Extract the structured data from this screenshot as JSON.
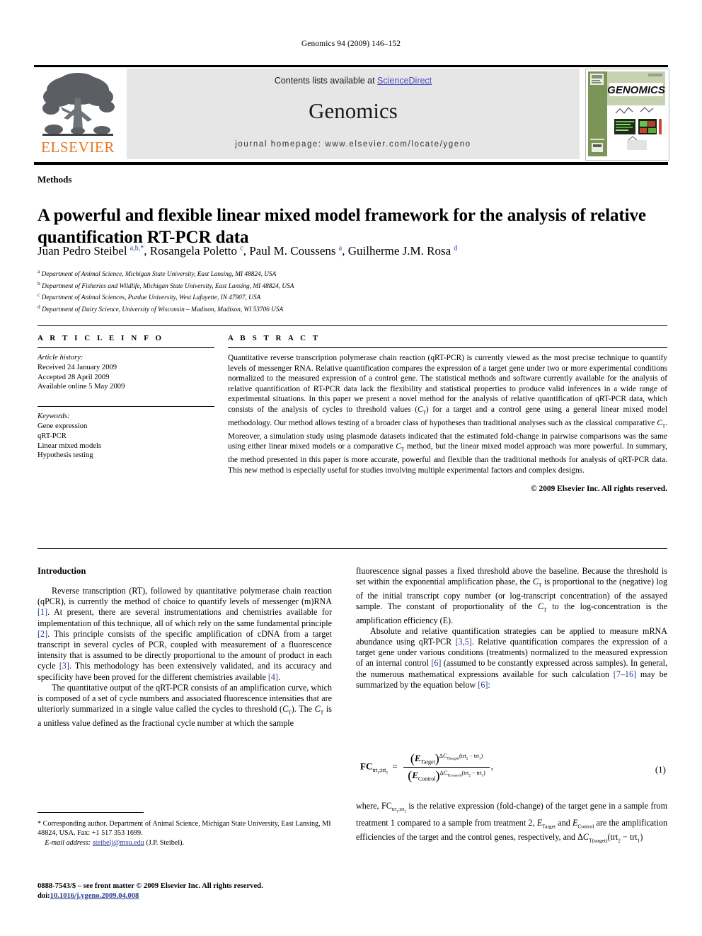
{
  "running_head": "Genomics 94 (2009) 146–152",
  "banner": {
    "publisher_wordmark": "ELSEVIER",
    "contents_prefix": "Contents lists available at ",
    "contents_link": "ScienceDirect",
    "journal_name": "Genomics",
    "homepage_line": "journal homepage: www.elsevier.com/locate/ygeno",
    "cover_title": "GENOMICS",
    "link_color": "#4a4ac4",
    "elsevier_orange": "#E87722",
    "banner_bg": "#e6e6e6"
  },
  "article": {
    "section_kind": "Methods",
    "title": "A powerful and flexible linear mixed model framework for the analysis of relative quantification RT-PCR data",
    "authors_html": "Juan Pedro Steibel <sup>a,b,*</sup>, Rosangela Poletto <sup>c</sup>, Paul M. Coussens <sup>a</sup>, Guilherme J.M. Rosa <sup>d</sup>",
    "affiliations": [
      {
        "mark": "a",
        "text": "Department of Animal Science, Michigan State University, East Lansing, MI 48824, USA"
      },
      {
        "mark": "b",
        "text": "Department of Fisheries and Wildlife, Michigan State University, East Lansing, MI 48824, USA"
      },
      {
        "mark": "c",
        "text": "Department of Animal Sciences, Purdue University, West Lafayette, IN 47907, USA"
      },
      {
        "mark": "d",
        "text": "Department of Dairy Science, University of Wisconsin – Madison, Madison, WI 53706 USA"
      }
    ]
  },
  "article_info": {
    "heading": "A R T I C L E   I N F O",
    "history_label": "Article history:",
    "history": [
      "Received 24 January 2009",
      "Accepted 28 April 2009",
      "Available online 5 May 2009"
    ],
    "keywords_label": "Keywords:",
    "keywords": [
      "Gene expression",
      "qRT-PCR",
      "Linear mixed models",
      "Hypothesis testing"
    ]
  },
  "abstract": {
    "heading": "A B S T R A C T",
    "text": "Quantitative reverse transcription polymerase chain reaction (qRT-PCR) is currently viewed as the most precise technique to quantify levels of messenger RNA. Relative quantification compares the expression of a target gene under two or more experimental conditions normalized to the measured expression of a control gene. The statistical methods and software currently available for the analysis of relative quantification of RT-PCR data lack the flexibility and statistical properties to produce valid inferences in a wide range of experimental situations. In this paper we present a novel method for the analysis of relative quantification of qRT-PCR data, which consists of the analysis of cycles to threshold values (CT) for a target and a control gene using a general linear mixed model methodology. Our method allows testing of a broader class of hypotheses than traditional analyses such as the classical comparative CT. Moreover, a simulation study using plasmode datasets indicated that the estimated fold-change in pairwise comparisons was the same using either linear mixed models or a comparative CT method, but the linear mixed model approach was more powerful. In summary, the method presented in this paper is more accurate, powerful and flexible than the traditional methods for analysis of qRT-PCR data. This new method is especially useful for studies involving multiple experimental factors and complex designs.",
    "copyright": "© 2009 Elsevier Inc. All rights reserved."
  },
  "body": {
    "intro_heading": "Introduction",
    "left_paragraphs": [
      "Reverse transcription (RT), followed by quantitative polymerase chain reaction (qPCR), is currently the method of choice to quantify levels of messenger (m)RNA [1]. At present, there are several instrumentations and chemistries available for implementation of this technique, all of which rely on the same fundamental principle [2]. This principle consists of the specific amplification of cDNA from a target transcript in several cycles of PCR, coupled with measurement of a fluorescence intensity that is assumed to be directly proportional to the amount of product in each cycle [3]. This methodology has been extensively validated, and its accuracy and specificity have been proved for the different chemistries available [4].",
      "The quantitative output of the qRT-PCR consists of an amplification curve, which is composed of a set of cycle numbers and associated fluorescence intensities that are ulteriorly summarized in a single value called the cycles to threshold (CT). The CT is a unitless value defined as the fractional cycle number at which the sample"
    ],
    "right_paragraphs": [
      "fluorescence signal passes a fixed threshold above the baseline. Because the threshold is set within the exponential amplification phase, the CT is proportional to the (negative) log of the initial transcript copy number (or log-transcript concentration) of the assayed sample. The constant of proportionality of the CT to the log-concentration is the amplification efficiency (E).",
      "Absolute and relative quantification strategies can be applied to measure mRNA abundance using qRT-PCR [3,5]. Relative quantification compares the expression of a target gene under various conditions (treatments) normalized to the measured expression of an internal control [6] (assumed to be constantly expressed across samples). In general, the numerous mathematical expressions available for such calculation [7–16] may be summarized by the equation below [6]:"
    ],
    "equation_number": "(1)",
    "equation_plain": "FC_trt1;trt2 = (E_Target)^(ΔC_T(target)(trt2 − trt1)) / (E_Control)^(ΔC_T(control)(trt2 − trt1)) ,",
    "after_equation": "where, FCtrt1;trt2 is the relative expression (fold-change) of the target gene in a sample from treatment 1 compared to a sample from treatment 2, ETarget and EControl are the amplification efficiencies of the target and the control genes, respectively, and ΔCT(target)(trt2 − trt1)"
  },
  "footer": {
    "corresponding_mark": "*",
    "corresponding_text": "Corresponding author. Department of Animal Science, Michigan State University, East Lansing, MI 48824, USA. Fax: +1 517 353 1699.",
    "email_label": "E-mail address:",
    "email": "steibelj@msu.edu",
    "email_attrib": "(J.P. Steibel).",
    "issn_line": "0888-7543/$ – see front matter © 2009 Elsevier Inc. All rights reserved.",
    "doi_label": "doi:",
    "doi": "10.1016/j.ygeno.2009.04.008"
  }
}
